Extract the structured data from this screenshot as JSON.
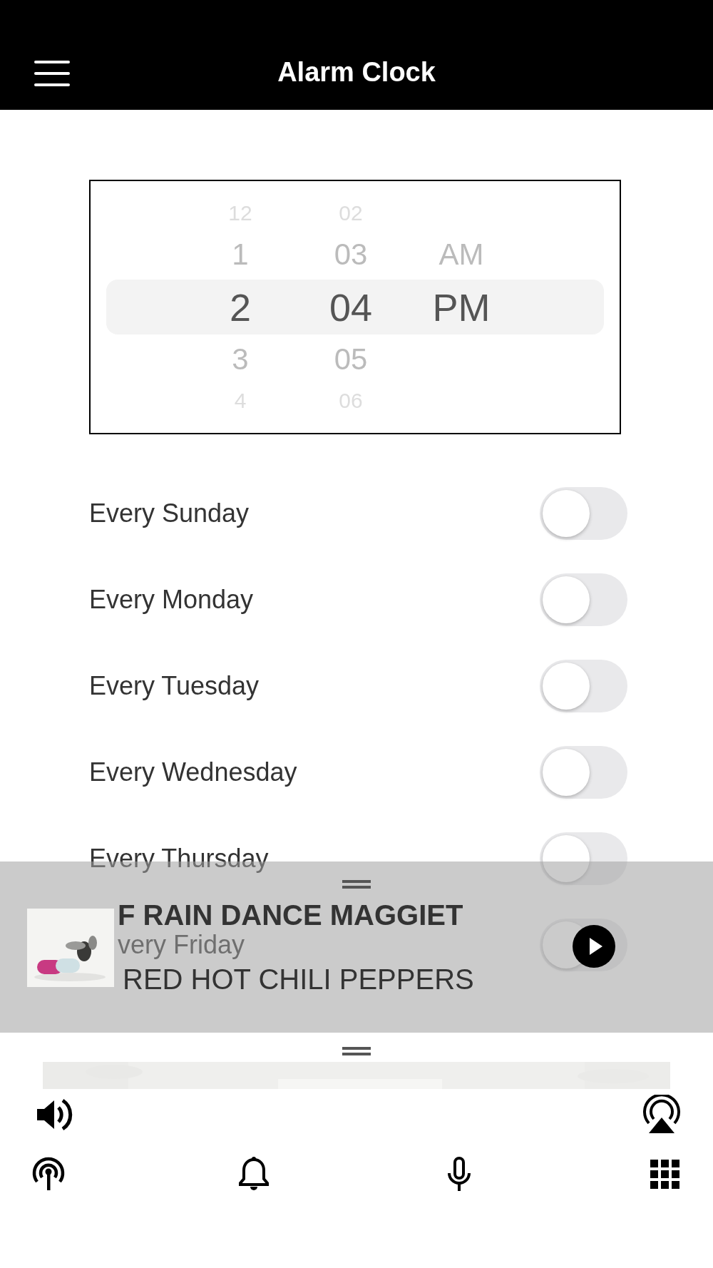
{
  "header": {
    "title": "Alarm Clock"
  },
  "time_picker": {
    "columns": [
      {
        "items": [
          {
            "label": "12",
            "selected": false
          },
          {
            "label": "1",
            "selected": false
          },
          {
            "label": "2",
            "selected": true
          },
          {
            "label": "3",
            "selected": false
          },
          {
            "label": "4",
            "selected": false
          }
        ]
      },
      {
        "items": [
          {
            "label": "02",
            "selected": false
          },
          {
            "label": "03",
            "selected": false
          },
          {
            "label": "04",
            "selected": true
          },
          {
            "label": "05",
            "selected": false
          },
          {
            "label": "06",
            "selected": false
          }
        ]
      },
      {
        "items": [
          {
            "label": "AM",
            "selected": false
          },
          {
            "label": "PM",
            "selected": true
          }
        ]
      }
    ]
  },
  "alarms": [
    {
      "label": "Every Sunday",
      "on": false
    },
    {
      "label": "Every Monday",
      "on": false
    },
    {
      "label": "Every Tuesday",
      "on": false
    },
    {
      "label": "Every Wednesday",
      "on": false
    },
    {
      "label": "Every Thursday",
      "on": false
    },
    {
      "label": "very Friday",
      "on": false
    }
  ],
  "now_playing": {
    "title": "F RAIN DANCE MAGGIET",
    "artist": "RED HOT CHILI PEPPERS",
    "playing": false
  }
}
